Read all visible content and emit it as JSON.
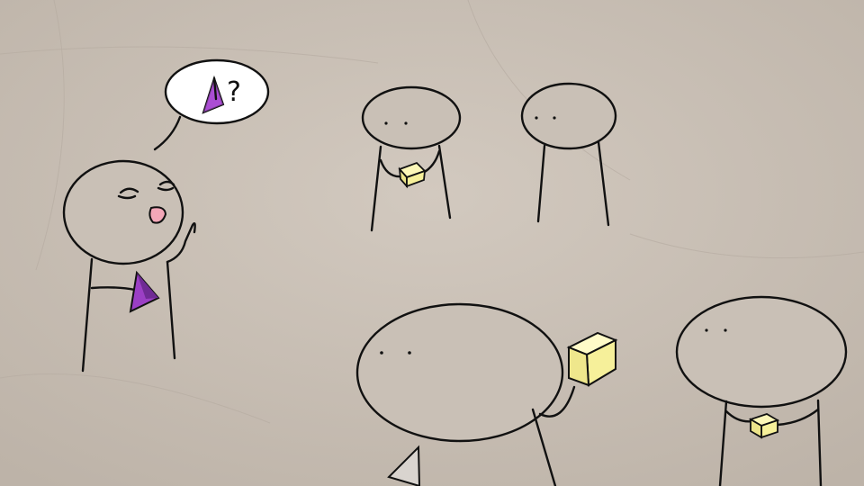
{
  "scene": {
    "background_color": "#c9c0b6",
    "ink_color": "#111111",
    "pyramid_color": "#9b3fc4",
    "cube_color": "#f6f09a",
    "speech_bubble": {
      "symbol": "?",
      "icon": "pyramid-icon"
    },
    "figures": [
      {
        "name": "speaker",
        "holds": "pyramid",
        "expression": "happy-talking"
      },
      {
        "name": "listener-top-left",
        "holds": "cube"
      },
      {
        "name": "listener-top-right",
        "holds": "nothing"
      },
      {
        "name": "listener-bottom-center",
        "holds": "cube",
        "also_holds": "pyramid-partial"
      },
      {
        "name": "listener-bottom-right",
        "holds": "cube"
      }
    ]
  }
}
